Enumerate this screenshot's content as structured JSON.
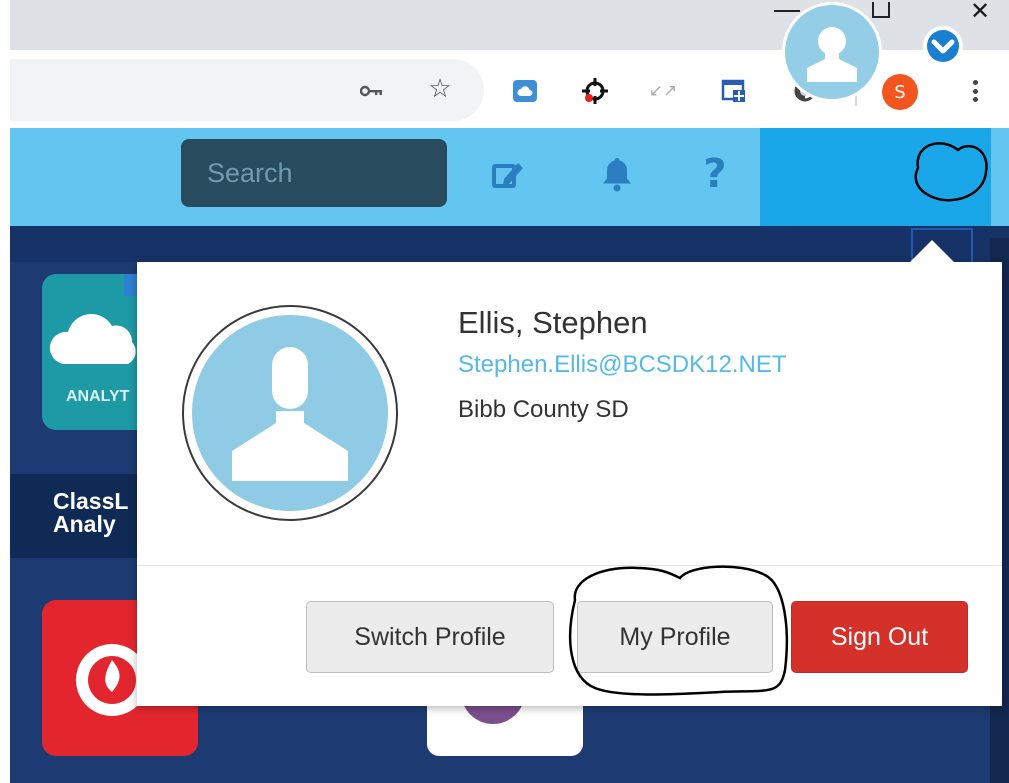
{
  "browser": {
    "window_controls": {
      "close_glyph": "✕"
    },
    "extensions": [
      "key-icon",
      "star-icon",
      "cloud-extension-icon",
      "target-extension-icon",
      "arrows-extension-icon",
      "window-extension-icon",
      "circle-extension-icon"
    ],
    "profile_initial": "S",
    "profile_color": "#f2561e"
  },
  "header": {
    "search_placeholder": "Search",
    "icons": [
      "edit-icon",
      "bell-icon",
      "help-icon"
    ],
    "help_glyph": "?",
    "bar_color": "#62c6f1",
    "user_area_color": "#1aa7ea"
  },
  "dashboard": {
    "tile_analytics": {
      "badge": "ANALYT",
      "caption": "ClassL\nAnaly"
    }
  },
  "profile_menu": {
    "name": "Ellis, Stephen",
    "email": "Stephen.Ellis@BCSDK12.NET",
    "organization": "Bibb County SD",
    "buttons": {
      "switch_profile": "Switch Profile",
      "my_profile": "My Profile",
      "sign_out": "Sign Out"
    },
    "sign_out_color": "#d5312b",
    "email_color": "#56b9ea"
  }
}
